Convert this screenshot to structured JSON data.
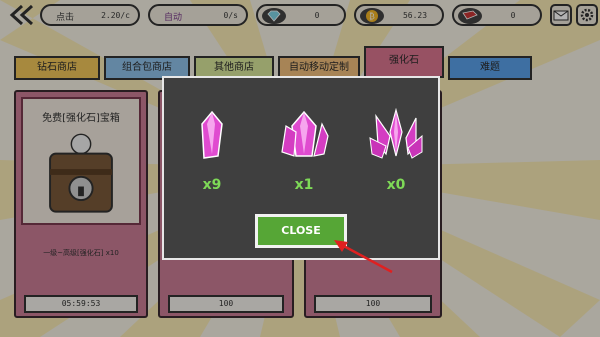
{
  "colors": {
    "accent_green": "#56a636",
    "count_green": "#7ed957",
    "card_pink": "#c97b94",
    "tab_active": "#d9748f",
    "arrow_red": "#e02020"
  },
  "topbar": {
    "back_icon": "double-chevron-left-icon",
    "click_label": "点击",
    "click_value": "2.20/c",
    "auto_label": "自动",
    "auto_value": "0/s",
    "diamond_icon": "diamond-icon",
    "diamond_value": "0",
    "coin_icon": "bitcoin-icon",
    "coin_value": "56.23",
    "gem_icon": "red-gem-icon",
    "gem_value": "0",
    "mail_icon": "mail-icon",
    "settings_icon": "gear-icon"
  },
  "tabs": [
    {
      "label": "钻石商店",
      "color": "#f0c55a"
    },
    {
      "label": "组合包商店",
      "color": "#8fc0e8"
    },
    {
      "label": "其他商店",
      "color": "#d7e59a"
    },
    {
      "label": "自动移动定制",
      "color": "#efbd7c"
    },
    {
      "label": "强化石",
      "color": "#d9748f"
    },
    {
      "label": "难题",
      "color": "#5aa0e8"
    }
  ],
  "cards": [
    {
      "title": "免费[强化石]宝箱",
      "desc": "一级~高级[强化石] x10",
      "button": "05:59:53"
    },
    {
      "title": "",
      "desc": "",
      "button": "100"
    },
    {
      "title": "",
      "desc": "",
      "button": "100"
    }
  ],
  "modal": {
    "items": [
      {
        "icon": "crystal-small-icon",
        "count": "x9"
      },
      {
        "icon": "crystal-cluster-icon",
        "count": "x1"
      },
      {
        "icon": "crystal-spiky-icon",
        "count": "x0"
      }
    ],
    "close_label": "CLOSE"
  }
}
